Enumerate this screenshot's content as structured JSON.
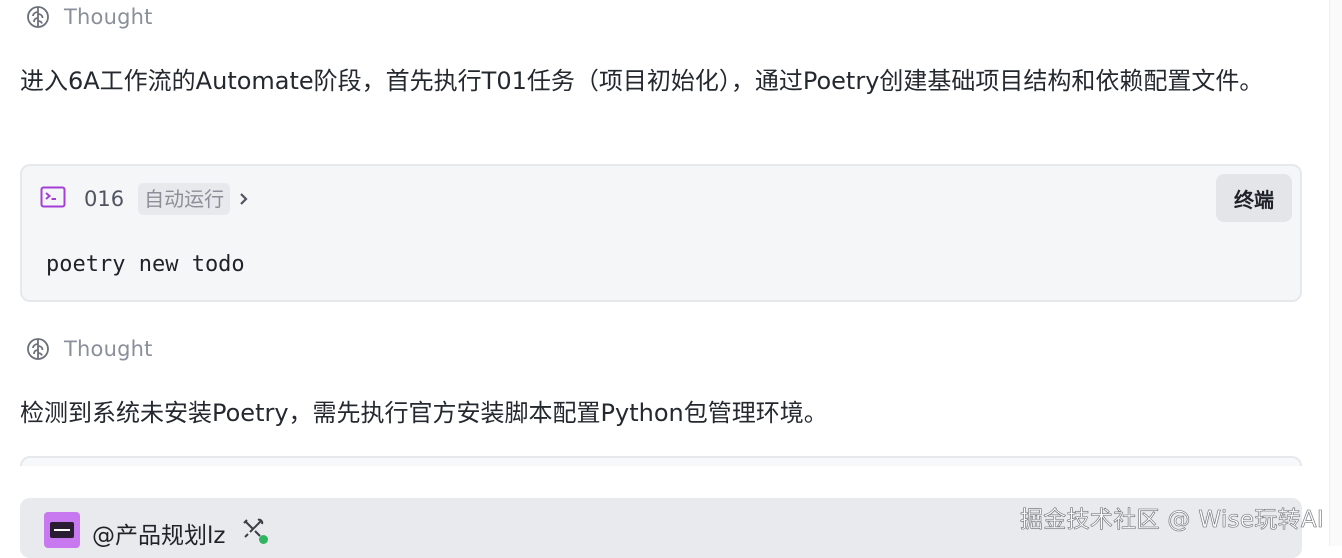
{
  "thoughts": [
    {
      "label": "Thought",
      "icon": "brain-icon",
      "text": "进入6A工作流的Automate阶段，首先执行T01任务（项目初始化），通过Poetry创建基础项目结构和依赖配置文件。"
    },
    {
      "label": "Thought",
      "icon": "brain-icon",
      "text": "检测到系统未安装Poetry，需先执行官方安装脚本配置Python包管理环境。"
    }
  ],
  "command": {
    "icon": "terminal-icon",
    "number": "016",
    "auto_label": "自动运行",
    "terminal_button": "终端",
    "code": "poetry new todo"
  },
  "user": {
    "name": "@产品规划lz",
    "avatar_icon": "avatar-icon",
    "badge_icon": "tools-icon",
    "status_color": "#2fb45f"
  },
  "watermark": "掘金技术社区 @ Wise玩转AI",
  "colors": {
    "accent": "#a33fd6",
    "card_bg": "#f5f6f8"
  }
}
